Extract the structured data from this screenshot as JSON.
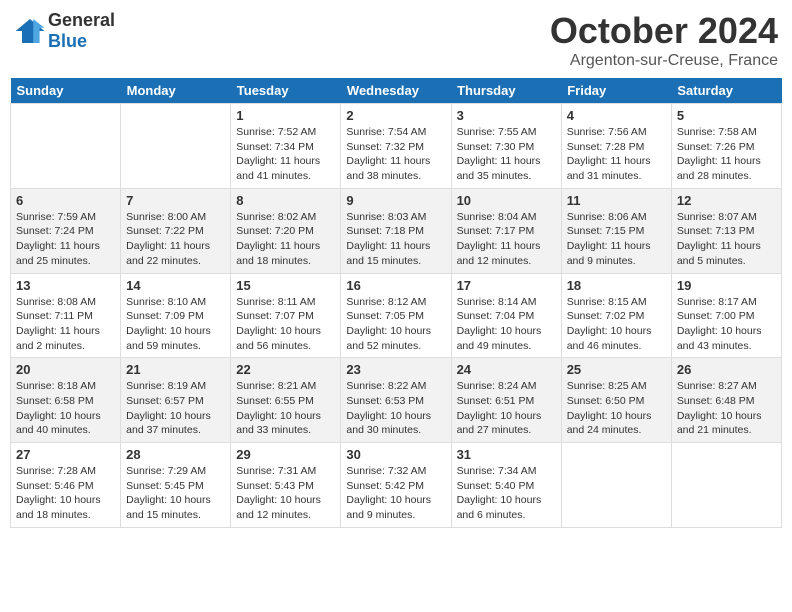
{
  "header": {
    "logo_general": "General",
    "logo_blue": "Blue",
    "month_title": "October 2024",
    "location": "Argenton-sur-Creuse, France"
  },
  "days_of_week": [
    "Sunday",
    "Monday",
    "Tuesday",
    "Wednesday",
    "Thursday",
    "Friday",
    "Saturday"
  ],
  "weeks": [
    [
      {
        "day": "",
        "sunrise": "",
        "sunset": "",
        "daylight": ""
      },
      {
        "day": "",
        "sunrise": "",
        "sunset": "",
        "daylight": ""
      },
      {
        "day": "1",
        "sunrise": "Sunrise: 7:52 AM",
        "sunset": "Sunset: 7:34 PM",
        "daylight": "Daylight: 11 hours and 41 minutes."
      },
      {
        "day": "2",
        "sunrise": "Sunrise: 7:54 AM",
        "sunset": "Sunset: 7:32 PM",
        "daylight": "Daylight: 11 hours and 38 minutes."
      },
      {
        "day": "3",
        "sunrise": "Sunrise: 7:55 AM",
        "sunset": "Sunset: 7:30 PM",
        "daylight": "Daylight: 11 hours and 35 minutes."
      },
      {
        "day": "4",
        "sunrise": "Sunrise: 7:56 AM",
        "sunset": "Sunset: 7:28 PM",
        "daylight": "Daylight: 11 hours and 31 minutes."
      },
      {
        "day": "5",
        "sunrise": "Sunrise: 7:58 AM",
        "sunset": "Sunset: 7:26 PM",
        "daylight": "Daylight: 11 hours and 28 minutes."
      }
    ],
    [
      {
        "day": "6",
        "sunrise": "Sunrise: 7:59 AM",
        "sunset": "Sunset: 7:24 PM",
        "daylight": "Daylight: 11 hours and 25 minutes."
      },
      {
        "day": "7",
        "sunrise": "Sunrise: 8:00 AM",
        "sunset": "Sunset: 7:22 PM",
        "daylight": "Daylight: 11 hours and 22 minutes."
      },
      {
        "day": "8",
        "sunrise": "Sunrise: 8:02 AM",
        "sunset": "Sunset: 7:20 PM",
        "daylight": "Daylight: 11 hours and 18 minutes."
      },
      {
        "day": "9",
        "sunrise": "Sunrise: 8:03 AM",
        "sunset": "Sunset: 7:18 PM",
        "daylight": "Daylight: 11 hours and 15 minutes."
      },
      {
        "day": "10",
        "sunrise": "Sunrise: 8:04 AM",
        "sunset": "Sunset: 7:17 PM",
        "daylight": "Daylight: 11 hours and 12 minutes."
      },
      {
        "day": "11",
        "sunrise": "Sunrise: 8:06 AM",
        "sunset": "Sunset: 7:15 PM",
        "daylight": "Daylight: 11 hours and 9 minutes."
      },
      {
        "day": "12",
        "sunrise": "Sunrise: 8:07 AM",
        "sunset": "Sunset: 7:13 PM",
        "daylight": "Daylight: 11 hours and 5 minutes."
      }
    ],
    [
      {
        "day": "13",
        "sunrise": "Sunrise: 8:08 AM",
        "sunset": "Sunset: 7:11 PM",
        "daylight": "Daylight: 11 hours and 2 minutes."
      },
      {
        "day": "14",
        "sunrise": "Sunrise: 8:10 AM",
        "sunset": "Sunset: 7:09 PM",
        "daylight": "Daylight: 10 hours and 59 minutes."
      },
      {
        "day": "15",
        "sunrise": "Sunrise: 8:11 AM",
        "sunset": "Sunset: 7:07 PM",
        "daylight": "Daylight: 10 hours and 56 minutes."
      },
      {
        "day": "16",
        "sunrise": "Sunrise: 8:12 AM",
        "sunset": "Sunset: 7:05 PM",
        "daylight": "Daylight: 10 hours and 52 minutes."
      },
      {
        "day": "17",
        "sunrise": "Sunrise: 8:14 AM",
        "sunset": "Sunset: 7:04 PM",
        "daylight": "Daylight: 10 hours and 49 minutes."
      },
      {
        "day": "18",
        "sunrise": "Sunrise: 8:15 AM",
        "sunset": "Sunset: 7:02 PM",
        "daylight": "Daylight: 10 hours and 46 minutes."
      },
      {
        "day": "19",
        "sunrise": "Sunrise: 8:17 AM",
        "sunset": "Sunset: 7:00 PM",
        "daylight": "Daylight: 10 hours and 43 minutes."
      }
    ],
    [
      {
        "day": "20",
        "sunrise": "Sunrise: 8:18 AM",
        "sunset": "Sunset: 6:58 PM",
        "daylight": "Daylight: 10 hours and 40 minutes."
      },
      {
        "day": "21",
        "sunrise": "Sunrise: 8:19 AM",
        "sunset": "Sunset: 6:57 PM",
        "daylight": "Daylight: 10 hours and 37 minutes."
      },
      {
        "day": "22",
        "sunrise": "Sunrise: 8:21 AM",
        "sunset": "Sunset: 6:55 PM",
        "daylight": "Daylight: 10 hours and 33 minutes."
      },
      {
        "day": "23",
        "sunrise": "Sunrise: 8:22 AM",
        "sunset": "Sunset: 6:53 PM",
        "daylight": "Daylight: 10 hours and 30 minutes."
      },
      {
        "day": "24",
        "sunrise": "Sunrise: 8:24 AM",
        "sunset": "Sunset: 6:51 PM",
        "daylight": "Daylight: 10 hours and 27 minutes."
      },
      {
        "day": "25",
        "sunrise": "Sunrise: 8:25 AM",
        "sunset": "Sunset: 6:50 PM",
        "daylight": "Daylight: 10 hours and 24 minutes."
      },
      {
        "day": "26",
        "sunrise": "Sunrise: 8:27 AM",
        "sunset": "Sunset: 6:48 PM",
        "daylight": "Daylight: 10 hours and 21 minutes."
      }
    ],
    [
      {
        "day": "27",
        "sunrise": "Sunrise: 7:28 AM",
        "sunset": "Sunset: 5:46 PM",
        "daylight": "Daylight: 10 hours and 18 minutes."
      },
      {
        "day": "28",
        "sunrise": "Sunrise: 7:29 AM",
        "sunset": "Sunset: 5:45 PM",
        "daylight": "Daylight: 10 hours and 15 minutes."
      },
      {
        "day": "29",
        "sunrise": "Sunrise: 7:31 AM",
        "sunset": "Sunset: 5:43 PM",
        "daylight": "Daylight: 10 hours and 12 minutes."
      },
      {
        "day": "30",
        "sunrise": "Sunrise: 7:32 AM",
        "sunset": "Sunset: 5:42 PM",
        "daylight": "Daylight: 10 hours and 9 minutes."
      },
      {
        "day": "31",
        "sunrise": "Sunrise: 7:34 AM",
        "sunset": "Sunset: 5:40 PM",
        "daylight": "Daylight: 10 hours and 6 minutes."
      },
      {
        "day": "",
        "sunrise": "",
        "sunset": "",
        "daylight": ""
      },
      {
        "day": "",
        "sunrise": "",
        "sunset": "",
        "daylight": ""
      }
    ]
  ]
}
